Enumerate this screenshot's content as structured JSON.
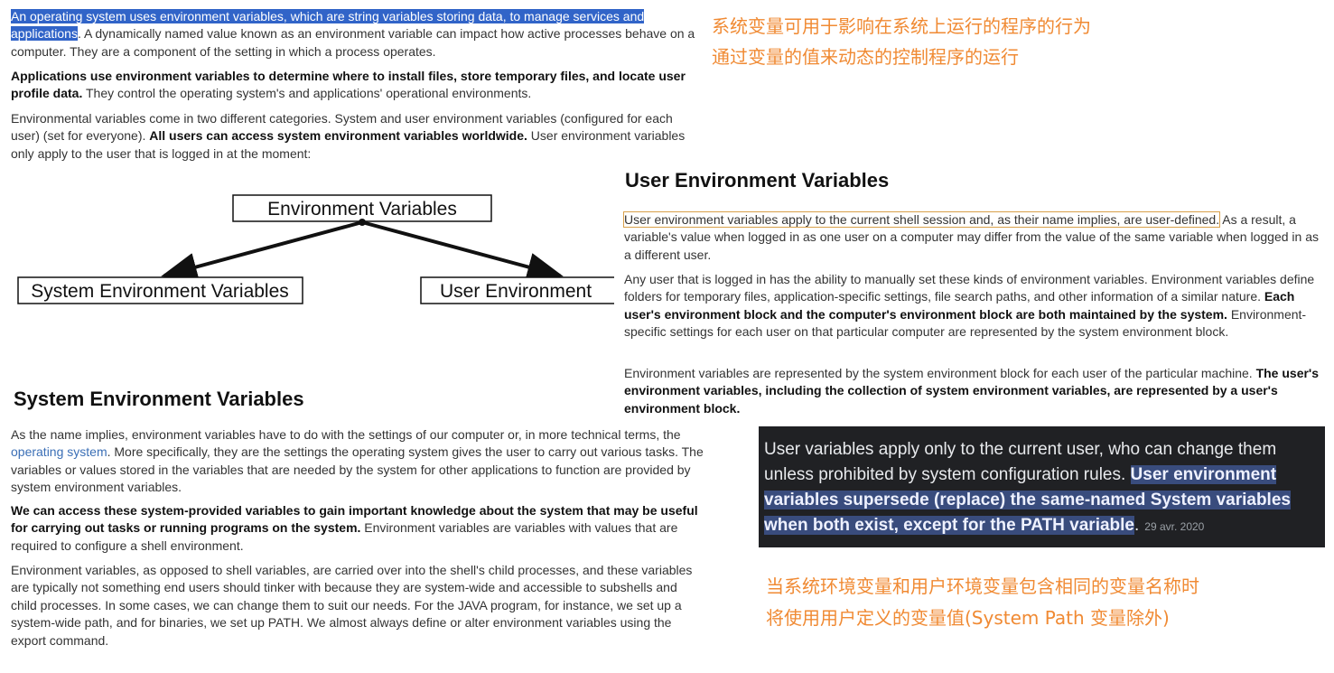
{
  "intro": {
    "p1_highlight": "An operating system uses environment variables, which are string variables storing data, to manage services and applications",
    "p1_rest": ". A dynamically named value known as an environment variable can impact how active processes behave on a computer. They are a component of the setting in which a process operates.",
    "p2_bold": "Applications use environment variables to determine where to install files, store temporary files, and locate user profile data.",
    "p2_rest": " They control the operating system's and applications' operational environments.",
    "p3_a": "Environmental variables come in two different categories. System and user environment variables (configured for each user) (set for everyone). ",
    "p3_bold": "All users can access system environment variables worldwide.",
    "p3_rest": " User environment variables only apply to the user that is logged in at the moment:"
  },
  "diagram": {
    "root": "Environment Variables",
    "left": "System Environment Variables",
    "right": "User Environment"
  },
  "annotations_cn": {
    "line1": "系统变量可用于影响在系统上运行的程序的行为",
    "line2": "通过变量的值来动态的控制程序的运行",
    "line3": "当系统环境变量和用户环境变量包含相同的变量名称时",
    "line4": "将使用用户定义的变量值(System Path 变量除外)"
  },
  "user_section": {
    "heading": "User Environment Variables",
    "p1_boxed": "User environment variables apply to the current shell session and, as their name implies, are user-defined.",
    "p1_rest": " As a result, a variable's value when logged in as one user on a computer may differ from the value of the same variable when logged in as a different user.",
    "p2_a": "Any user that is logged in has the ability to manually set these kinds of environment variables. Environment variables define folders for temporary files, application-specific settings, file search paths, and other information of a similar nature. ",
    "p2_bold": "Each user's environment block and the computer's environment block are both maintained by the system.",
    "p2_rest": " Environment-specific settings for each user on that particular computer are represented by the system environment block.",
    "p3_a": "Environment variables are represented by the system environment block for each user of the particular machine. ",
    "p3_bold": "The user's environment variables, including the collection of system environment variables, are represented by a user's environment block."
  },
  "system_section": {
    "heading": "System Environment Variables",
    "p1_a": "As the name implies, environment variables have to do with the settings of our computer or, in more technical terms, the ",
    "p1_link": "operating system",
    "p1_rest": ". More specifically, they are the settings the operating system gives the user to carry out various tasks. The variables or values stored in the variables that are needed by the system for other applications to function are provided by system environment variables.",
    "p2_bold": "We can access these system-provided variables to gain important knowledge about the system that may be useful for carrying out tasks or running programs on the system.",
    "p2_rest": " Environment variables are variables with values that are required to configure a shell environment.",
    "p3": "Environment variables, as opposed to shell variables, are carried over into the shell's child processes, and these variables are typically not something end users should tinker with because they are system-wide and accessible to subshells and child processes. In some cases, we can change them to suit our needs. For the JAVA program, for instance, we set up a system-wide path, and for binaries, we set up PATH. We almost always define or alter environment variables using the export command."
  },
  "snippet": {
    "plain": "User variables apply only to the current user, who can change them unless prohibited by system configuration rules. ",
    "selected": "User environment variables supersede (replace) the same-named System variables when both exist, except for the PATH variable",
    "period": ".",
    "date": "29 avr. 2020"
  },
  "colors": {
    "highlight": "#3164c8",
    "annotation": "#f08a33",
    "snippet_bg": "#202124",
    "snippet_selection": "#394c7d",
    "link": "#3b6fb6"
  }
}
